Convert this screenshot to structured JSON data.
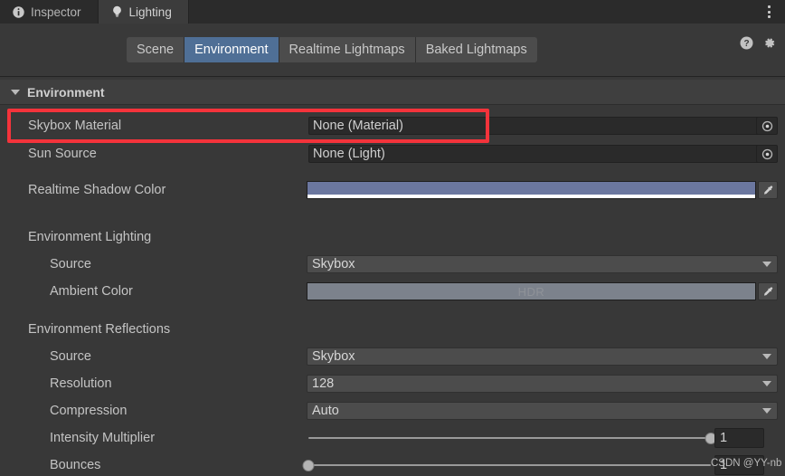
{
  "window": {
    "tabs": [
      {
        "label": "Inspector",
        "icon": "info-icon",
        "active": false
      },
      {
        "label": "Lighting",
        "icon": "lightbulb-icon",
        "active": true
      }
    ],
    "menu_icon": "kebab-menu-icon"
  },
  "toolbar": {
    "tabs": [
      {
        "label": "Scene",
        "active": false
      },
      {
        "label": "Environment",
        "active": true
      },
      {
        "label": "Realtime Lightmaps",
        "active": false
      },
      {
        "label": "Baked Lightmaps",
        "active": false
      }
    ],
    "help_icon": "help-icon",
    "settings_icon": "gear-icon",
    "active_color": "#4f6f96"
  },
  "foldout": {
    "title": "Environment",
    "expanded": true,
    "icon": "triangle-down-icon"
  },
  "rows": {
    "skybox_material": {
      "label": "Skybox Material",
      "value": "None (Material)",
      "picker_icon": "object-picker-icon"
    },
    "sun_source": {
      "label": "Sun Source",
      "value": "None (Light)",
      "picker_icon": "object-picker-icon"
    },
    "realtime_shadow_color": {
      "label": "Realtime Shadow Color",
      "color": "#6b779f",
      "alpha_color": "#ffffff",
      "eyedropper_icon": "eyedropper-icon"
    },
    "environment_lighting": {
      "label": "Environment Lighting",
      "source": {
        "label": "Source",
        "value": "Skybox"
      },
      "ambient_color": {
        "label": "Ambient Color",
        "color": "#7c828c",
        "badge": "HDR",
        "eyedropper_icon": "eyedropper-icon"
      }
    },
    "environment_reflections": {
      "label": "Environment Reflections",
      "source": {
        "label": "Source",
        "value": "Skybox"
      },
      "resolution": {
        "label": "Resolution",
        "value": "128"
      },
      "compression": {
        "label": "Compression",
        "value": "Auto"
      },
      "intensity_multiplier": {
        "label": "Intensity Multiplier",
        "value": "1",
        "slider_percent": 100
      },
      "bounces": {
        "label": "Bounces",
        "value": "1",
        "slider_percent": 0
      }
    }
  },
  "annotation": {
    "target": "skybox-material-row",
    "color": "#f4333b"
  },
  "watermark": {
    "text": "CSDN @YY-nb"
  }
}
